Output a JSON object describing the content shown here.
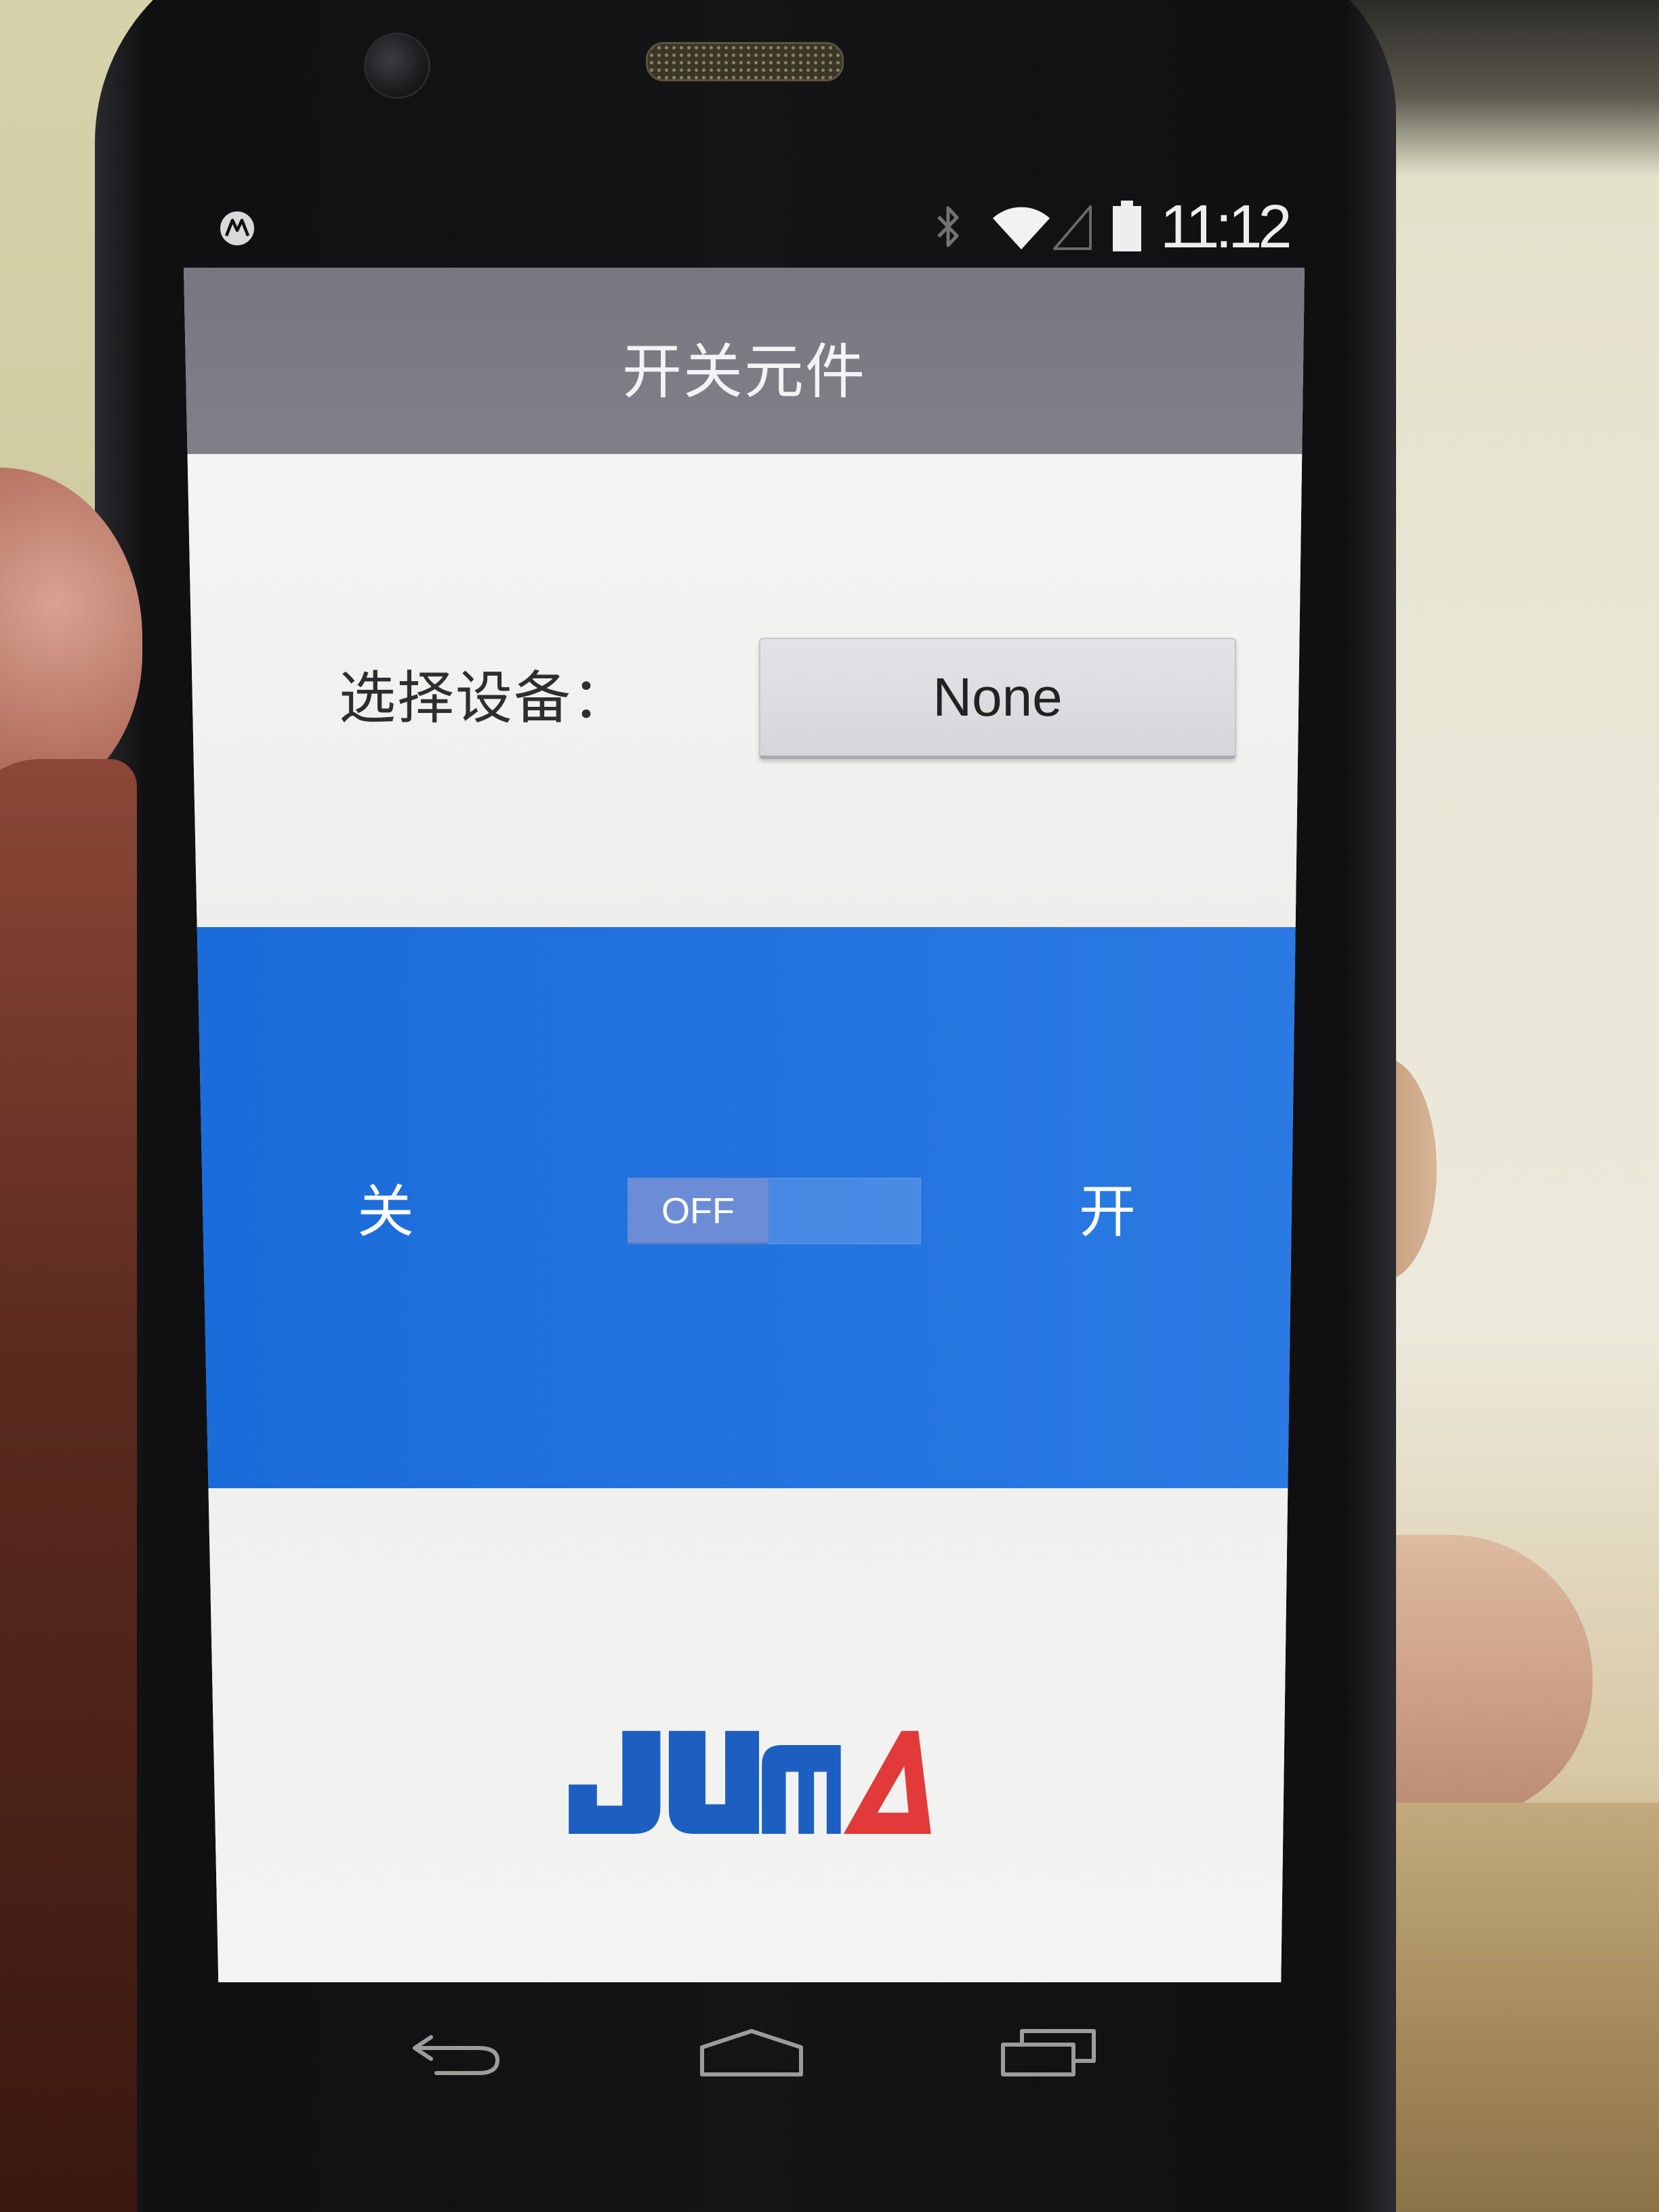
{
  "status_bar": {
    "time": "11:12",
    "icons": [
      "motorola-logo-icon",
      "bluetooth-icon",
      "wifi-icon",
      "signal-icon",
      "battery-icon"
    ]
  },
  "app_bar": {
    "title": "开关元件"
  },
  "device_select": {
    "label": "选择设备：",
    "value": "None"
  },
  "switch_panel": {
    "off_label": "关",
    "on_label": "开",
    "toggle_text": "OFF",
    "toggle_on": false
  },
  "footer": {
    "logo_text": "JUMA"
  },
  "nav_bar": {
    "buttons": [
      "back-icon",
      "home-icon",
      "recents-icon"
    ]
  },
  "colors": {
    "app_bar": "#78767e",
    "switch_panel": "#1b70e2",
    "toggle_thumb": "#6c8dd6",
    "button": "#d6d6da",
    "logo_blue": "#1d5fc1",
    "logo_red": "#e23a3a"
  }
}
